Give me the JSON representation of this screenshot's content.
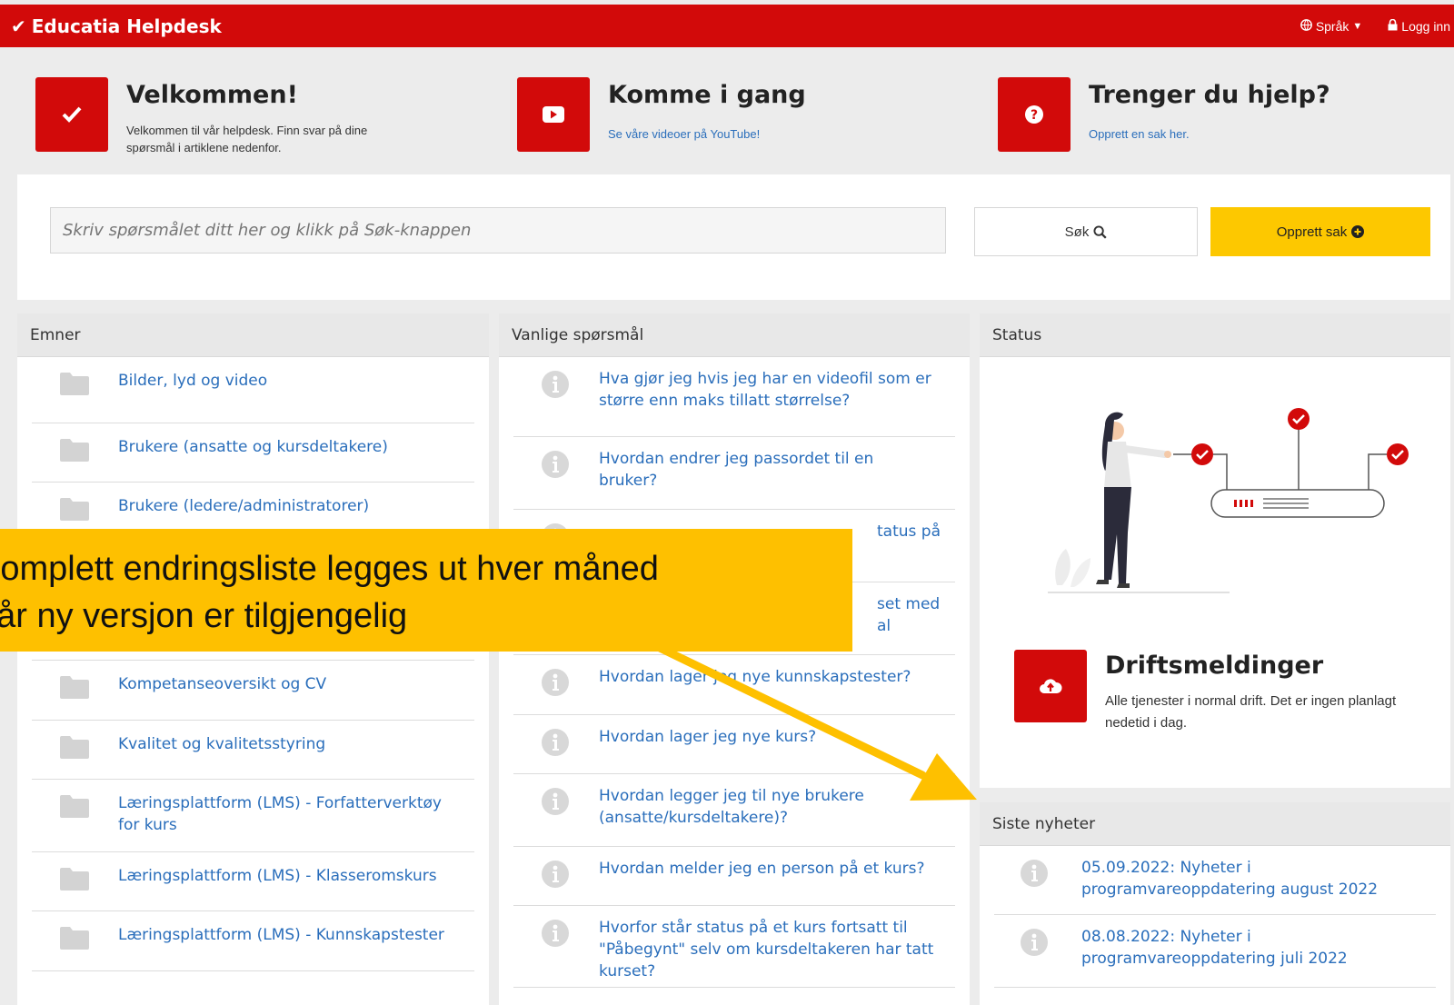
{
  "header": {
    "brand": "Educatia Helpdesk",
    "language_label": "Språk",
    "login_label": "Logg inn"
  },
  "hero": {
    "welcome": {
      "title": "Velkommen!",
      "text": "Velkommen til vår helpdesk. Finn svar på dine spørsmål i artiklene nedenfor."
    },
    "getting_started": {
      "title": "Komme i gang",
      "link": "Se våre videoer på YouTube!"
    },
    "help": {
      "title": "Trenger du hjelp?",
      "link": "Opprett en sak her."
    }
  },
  "search": {
    "placeholder": "Skriv spørsmålet ditt her og klikk på Søk-knappen",
    "search_button": "Søk",
    "create_button": "Opprett sak"
  },
  "topics": {
    "title": "Emner",
    "items": [
      {
        "label": "Bilder, lyd og video"
      },
      {
        "label": "Brukere (ansatte og kursdeltakere)"
      },
      {
        "label": "Brukere (ledere/administratorer)"
      },
      {
        "label": ""
      },
      {
        "label": ""
      },
      {
        "label": "Kompetanseoversikt og CV"
      },
      {
        "label": "Kvalitet og kvalitetsstyring"
      },
      {
        "label": "Læringsplattform (LMS) - Forfatterverktøy for kurs"
      },
      {
        "label": "Læringsplattform (LMS) - Klasseromskurs"
      },
      {
        "label": "Læringsplattform (LMS) - Kunnskapstester"
      }
    ]
  },
  "faq": {
    "title": "Vanlige spørsmål",
    "items": [
      {
        "label": "Hva gjør jeg hvis jeg har en videofil som er større enn maks tillatt størrelse?"
      },
      {
        "label": "Hvordan endrer jeg passordet til en bruker?"
      },
      {
        "label": "tatus på"
      },
      {
        "label": "set med\nal"
      },
      {
        "label": "Hvordan lager jeg nye kunnskapstester?"
      },
      {
        "label": "Hvordan lager jeg nye kurs?"
      },
      {
        "label": "Hvordan legger jeg til nye brukere (ansatte/kursdeltakere)?"
      },
      {
        "label": "Hvordan melder jeg en person på et kurs?"
      },
      {
        "label": "Hvorfor står status på et kurs fortsatt til \"Påbegynt\" selv om kursdeltakeren har tatt kurset?"
      }
    ]
  },
  "status": {
    "title": "Status",
    "drift_title": "Driftsmeldinger",
    "drift_text": "Alle tjenester i normal drift. Det er ingen planlagt nedetid i dag."
  },
  "news": {
    "title": "Siste nyheter",
    "items": [
      {
        "label": "05.09.2022: Nyheter i programvareoppdatering august 2022"
      },
      {
        "label": "08.08.2022: Nyheter i programvareoppdatering juli 2022"
      }
    ]
  },
  "callout": {
    "line1": "Komplett endringsliste legges ut hver måned",
    "line2": "når ny versjon er tilgjengelig"
  },
  "colors": {
    "brand_red": "#d20a0a",
    "accent_yellow": "#fdc800",
    "link_blue": "#2a6ebb",
    "callout": "#fec000"
  }
}
